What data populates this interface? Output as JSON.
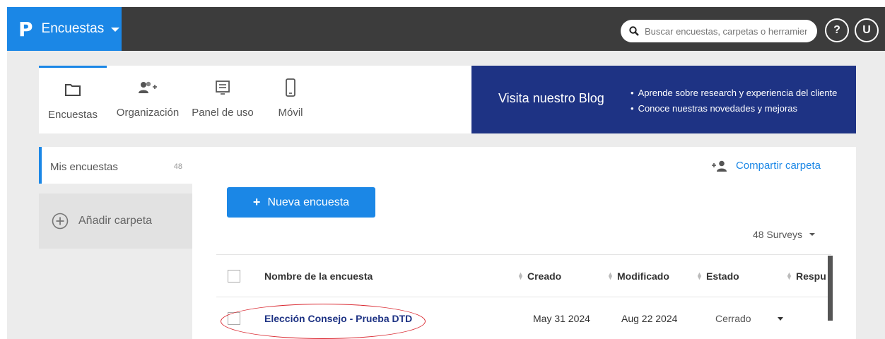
{
  "topbar": {
    "app_title": "Encuestas",
    "search_placeholder": "Buscar encuestas, carpetas o herramient",
    "help_label": "?",
    "user_initial": "U"
  },
  "nav": {
    "tabs": [
      {
        "label": "Encuestas",
        "icon": "folder-icon",
        "active": true
      },
      {
        "label": "Organización",
        "icon": "add-user-icon",
        "active": false
      },
      {
        "label": "Panel de uso",
        "icon": "dashboard-icon",
        "active": false
      },
      {
        "label": "Móvil",
        "icon": "mobile-icon",
        "active": false
      }
    ]
  },
  "blog": {
    "title": "Visita nuestro Blog",
    "bullets": [
      "Aprende sobre research y experiencia del cliente",
      "Conoce nuestras novedades y mejoras"
    ]
  },
  "sidebar": {
    "my_surveys_label": "Mis encuestas",
    "my_surveys_count": "48",
    "add_folder_label": "Añadir carpeta"
  },
  "main": {
    "share_label": "Compartir carpeta",
    "new_survey_label": "Nueva encuesta",
    "surveys_count_label": "48 Surveys"
  },
  "table": {
    "headers": {
      "name": "Nombre de la encuesta",
      "created": "Creado",
      "modified": "Modificado",
      "status": "Estado",
      "responses": "Respu"
    },
    "rows": [
      {
        "name": "Elección Consejo - Prueba DTD",
        "created": "May 31 2024",
        "modified": "Aug 22 2024",
        "status": "Cerrado"
      }
    ]
  },
  "colors": {
    "brand_blue": "#1b87e6",
    "topbar_dark": "#3c3c3c",
    "banner_navy": "#1e3384",
    "highlight_red": "#d9262e"
  }
}
